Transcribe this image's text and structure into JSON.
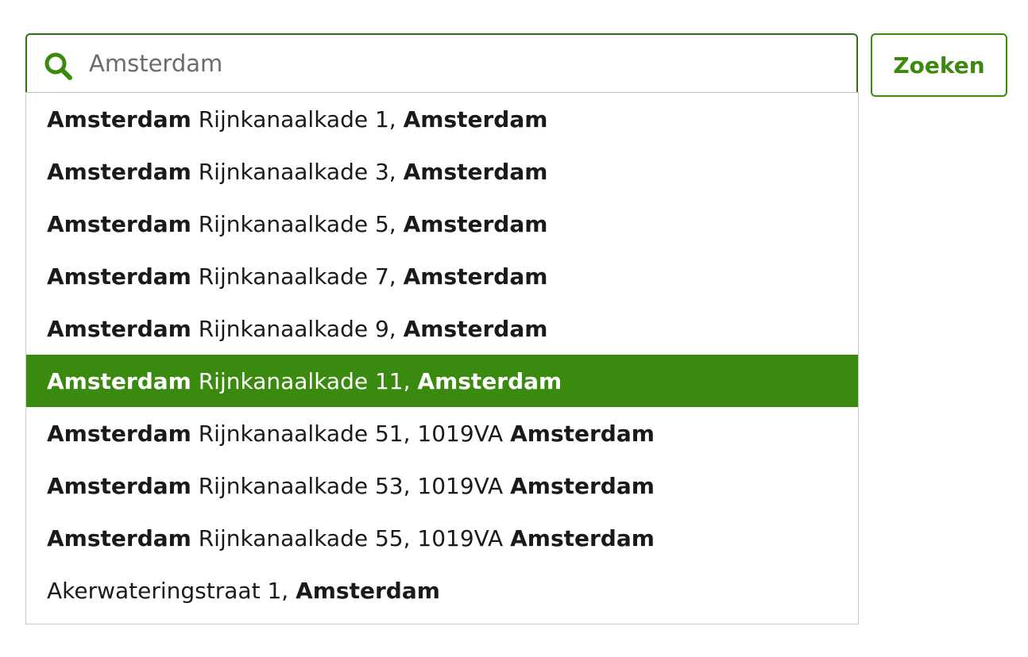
{
  "search": {
    "value": "Amsterdam",
    "icon": "search-icon",
    "button_label": "Zoeken"
  },
  "colors": {
    "accent": "#3a8a10",
    "border": "#2f6f18",
    "highlight_text": "#ffffff"
  },
  "suggestions": [
    {
      "prefix": "Amsterdam",
      "address": "Rijnkanaalkade 1,",
      "postcode": "",
      "city": "Amsterdam",
      "active": false
    },
    {
      "prefix": "Amsterdam",
      "address": "Rijnkanaalkade 3,",
      "postcode": "",
      "city": "Amsterdam",
      "active": false
    },
    {
      "prefix": "Amsterdam",
      "address": "Rijnkanaalkade 5,",
      "postcode": "",
      "city": "Amsterdam",
      "active": false
    },
    {
      "prefix": "Amsterdam",
      "address": "Rijnkanaalkade 7,",
      "postcode": "",
      "city": "Amsterdam",
      "active": false
    },
    {
      "prefix": "Amsterdam",
      "address": "Rijnkanaalkade 9,",
      "postcode": "",
      "city": "Amsterdam",
      "active": false
    },
    {
      "prefix": "Amsterdam",
      "address": "Rijnkanaalkade 11,",
      "postcode": "",
      "city": "Amsterdam",
      "active": true
    },
    {
      "prefix": "Amsterdam",
      "address": "Rijnkanaalkade 51,",
      "postcode": "1019VA",
      "city": "Amsterdam",
      "active": false
    },
    {
      "prefix": "Amsterdam",
      "address": "Rijnkanaalkade 53,",
      "postcode": "1019VA",
      "city": "Amsterdam",
      "active": false
    },
    {
      "prefix": "Amsterdam",
      "address": "Rijnkanaalkade 55,",
      "postcode": "1019VA",
      "city": "Amsterdam",
      "active": false
    },
    {
      "prefix": "",
      "address": "Akerwateringstraat 1,",
      "postcode": "",
      "city": "Amsterdam",
      "active": false
    }
  ]
}
